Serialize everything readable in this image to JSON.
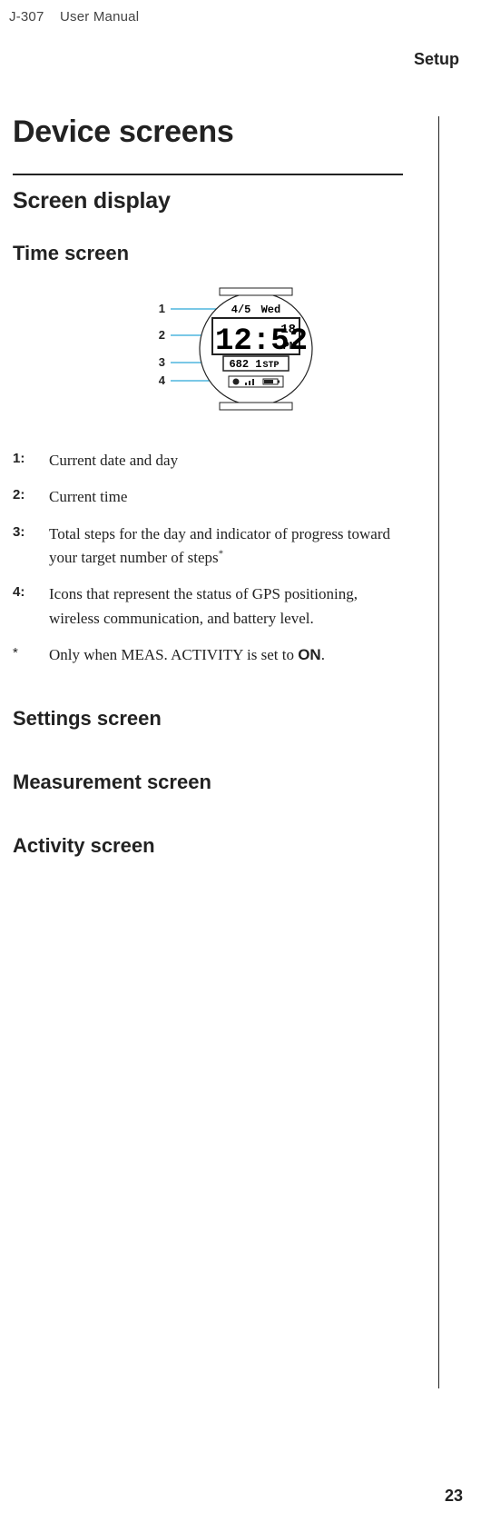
{
  "header": {
    "product": "J-307",
    "doc": "User Manual"
  },
  "section_label": "Setup",
  "title": "Device screens",
  "subhead": "Screen display",
  "time_screen": {
    "heading": "Time screen",
    "callout_labels": [
      "1",
      "2",
      "3",
      "4"
    ],
    "display": {
      "date": "4/5",
      "dow": "Wed",
      "time_main": "12:52",
      "time_sec": "18",
      "ampm": "PM",
      "steps": "682 1",
      "step_unit": "STP"
    },
    "defs": [
      {
        "key": "1:",
        "val_plain": "Current date and day"
      },
      {
        "key": "2:",
        "val_plain": "Current time"
      },
      {
        "key": "3:",
        "val_html": "Total steps for the day and indicator of progress toward your target number of steps<sup>*</sup>"
      },
      {
        "key": "4:",
        "val_plain": "Icons that represent the status of GPS positioning, wireless communication, and battery level."
      }
    ],
    "footnote": {
      "key": "*",
      "val_html": "Only when MEAS. ACTIVITY is set to <strong>ON</strong>."
    }
  },
  "other_heads": {
    "settings": "Settings screen",
    "measurement": "Measurement screen",
    "activity": "Activity screen"
  },
  "page_number": "23"
}
